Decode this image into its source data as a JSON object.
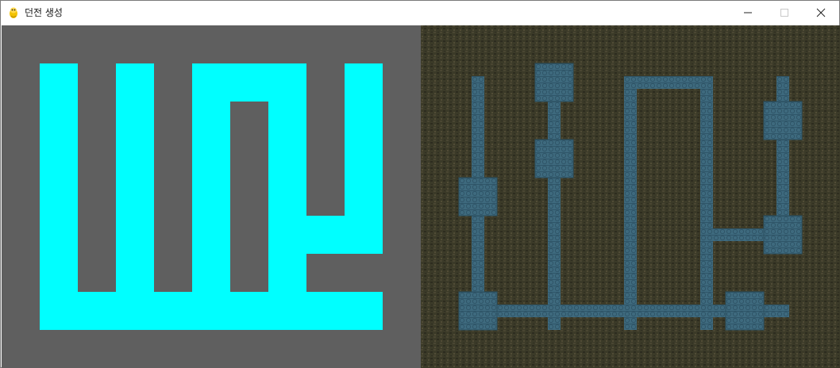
{
  "window": {
    "title": "던전 생성",
    "icon": "pygame-snake-icon",
    "controls": [
      "minimize-icon",
      "maximize-icon",
      "close-icon"
    ]
  },
  "colors": {
    "left_background": "#5f5f5f",
    "left_path": "#00ffff",
    "right_background": "#3b3a28",
    "right_floor": "#3e6a7e"
  },
  "panels": {
    "left": "maze-grid-view",
    "right": "dungeon-tile-view"
  }
}
